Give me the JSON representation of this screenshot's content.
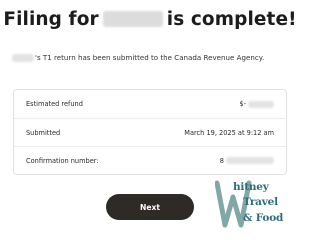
{
  "header": {
    "title_prefix": "Filing for",
    "title_suffix": "is complete!"
  },
  "message": {
    "text": "'s T1 return has been submitted to the Canada Revenue Agency."
  },
  "summary": {
    "rows": [
      {
        "label": "Estimated refund",
        "value_prefix": "$-"
      },
      {
        "label": "Submitted",
        "value": "March 19, 2025 at 9:12 am"
      },
      {
        "label": "Confirmation number:",
        "value_prefix": "8"
      }
    ]
  },
  "actions": {
    "next_label": "Next"
  },
  "watermark": {
    "line1": "hitney",
    "line2": "Travel",
    "line3": "& Food",
    "color": "#2e6d7a",
    "accent_color": "#7fa8a6"
  }
}
